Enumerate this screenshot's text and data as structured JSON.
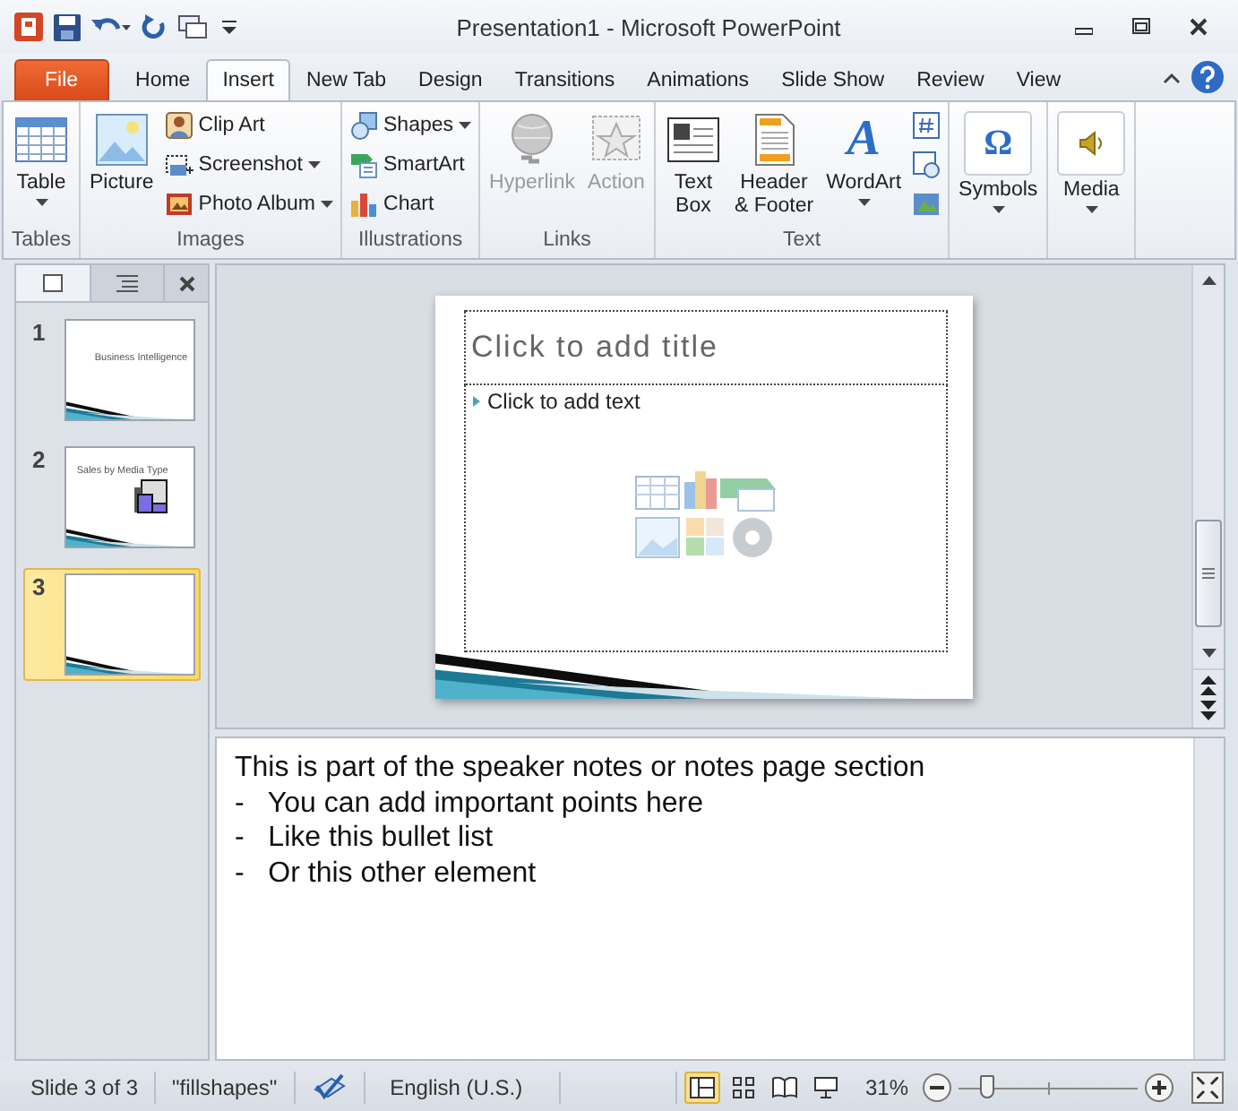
{
  "window": {
    "title": "Presentation1  -  Microsoft PowerPoint"
  },
  "ribbon_tabs": [
    {
      "label": "File",
      "kind": "file",
      "selected": false
    },
    {
      "label": "Home",
      "kind": "tab",
      "selected": false
    },
    {
      "label": "Insert",
      "kind": "tab",
      "selected": true
    },
    {
      "label": "New Tab",
      "kind": "tab",
      "selected": false
    },
    {
      "label": "Design",
      "kind": "tab",
      "selected": false
    },
    {
      "label": "Transitions",
      "kind": "tab",
      "selected": false
    },
    {
      "label": "Animations",
      "kind": "tab",
      "selected": false
    },
    {
      "label": "Slide Show",
      "kind": "tab",
      "selected": false
    },
    {
      "label": "Review",
      "kind": "tab",
      "selected": false
    },
    {
      "label": "View",
      "kind": "tab",
      "selected": false
    }
  ],
  "ribbon_groups": [
    {
      "label": "Tables",
      "buttons": [
        {
          "kind": "large",
          "label": "Table",
          "dropdown": true,
          "disabled": false
        }
      ]
    },
    {
      "label": "Images",
      "buttons": [
        {
          "kind": "large",
          "label": "Picture",
          "dropdown": false,
          "disabled": false
        },
        {
          "kind": "small",
          "label": "Clip Art",
          "dropdown": false,
          "disabled": false
        },
        {
          "kind": "small",
          "label": "Screenshot",
          "dropdown": true,
          "disabled": false
        },
        {
          "kind": "small",
          "label": "Photo Album",
          "dropdown": true,
          "disabled": false
        }
      ]
    },
    {
      "label": "Illustrations",
      "buttons": [
        {
          "kind": "small",
          "label": "Shapes",
          "dropdown": true,
          "disabled": false
        },
        {
          "kind": "small",
          "label": "SmartArt",
          "dropdown": false,
          "disabled": false
        },
        {
          "kind": "small",
          "label": "Chart",
          "dropdown": false,
          "disabled": false
        }
      ]
    },
    {
      "label": "Links",
      "buttons": [
        {
          "kind": "large",
          "label": "Hyperlink",
          "dropdown": false,
          "disabled": true
        },
        {
          "kind": "large",
          "label": "Action",
          "dropdown": false,
          "disabled": true
        }
      ]
    },
    {
      "label": "Text",
      "buttons": [
        {
          "kind": "large",
          "label": "Text\nBox",
          "dropdown": false,
          "disabled": false
        },
        {
          "kind": "large",
          "label": "Header\n& Footer",
          "dropdown": false,
          "disabled": false
        },
        {
          "kind": "large",
          "label": "WordArt",
          "glyph": "A",
          "dropdown": true,
          "disabled": false
        },
        {
          "kind": "icon",
          "dropdown": false,
          "disabled": false
        },
        {
          "kind": "icon",
          "dropdown": false,
          "disabled": false
        },
        {
          "kind": "icon",
          "dropdown": false,
          "disabled": false
        }
      ]
    },
    {
      "buttons": [
        {
          "kind": "large",
          "label": "Symbols",
          "glyph": "Ω",
          "dropdown": true,
          "disabled": false
        }
      ]
    },
    {
      "buttons": [
        {
          "kind": "large",
          "label": "Media",
          "dropdown": true,
          "disabled": false
        }
      ]
    }
  ],
  "slides_pane": {
    "tabs": [
      {
        "selected": true
      },
      {
        "selected": false
      }
    ]
  },
  "slides": [
    {
      "number": "1",
      "kind": "title",
      "title": "Business Intelligence",
      "selected": false
    },
    {
      "number": "2",
      "kind": "chart",
      "title": "Sales by Media Type",
      "selected": false
    },
    {
      "number": "3",
      "kind": "blank",
      "selected": true
    }
  ],
  "slide": {
    "title_placeholder": "Click to add title",
    "body_placeholder": "Click to add text"
  },
  "notes": [
    "This is part of the speaker notes or notes page section",
    "-   You can add important points here",
    "-   Like this bullet list",
    "-   Or this other element"
  ],
  "status_bar": {
    "slide": "Slide 3 of 3",
    "theme": "\"fillshapes\"",
    "language": "English (U.S.)",
    "views": [
      {
        "selected": true
      },
      {
        "selected": false
      },
      {
        "selected": false
      },
      {
        "selected": false
      }
    ],
    "zoom": "31%",
    "zoom_slider": {
      "level": 0.16
    }
  }
}
